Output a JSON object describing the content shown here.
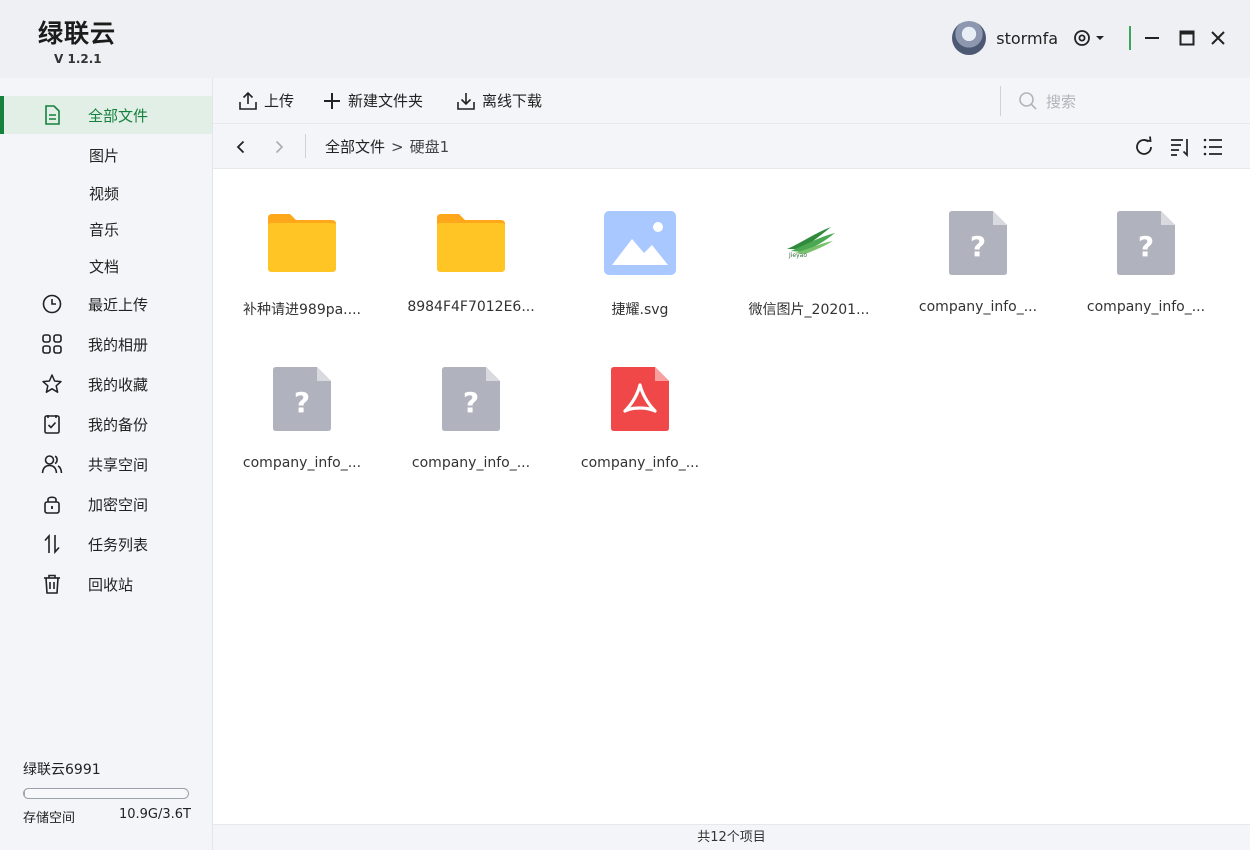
{
  "app": {
    "name": "绿联云",
    "version": "V 1.2.1"
  },
  "user": {
    "name": "stormfa"
  },
  "toolbar": {
    "upload_label": "上传",
    "new_folder_label": "新建文件夹",
    "offline_download_label": "离线下载",
    "search_placeholder": "搜索"
  },
  "breadcrumb": {
    "root": "全部文件",
    "sep": ">",
    "current": "硬盘1"
  },
  "sidebar": {
    "items": [
      {
        "label": "全部文件",
        "icon": "file-icon",
        "active": true
      },
      {
        "label": "图片"
      },
      {
        "label": "视频"
      },
      {
        "label": "音乐"
      },
      {
        "label": "文档"
      },
      {
        "label": "最近上传",
        "icon": "clock-icon"
      },
      {
        "label": "我的相册",
        "icon": "grid-icon"
      },
      {
        "label": "我的收藏",
        "icon": "star-icon"
      },
      {
        "label": "我的备份",
        "icon": "backup-icon"
      },
      {
        "label": "共享空间",
        "icon": "users-icon"
      },
      {
        "label": "加密空间",
        "icon": "lock-icon"
      },
      {
        "label": "任务列表",
        "icon": "transfer-icon"
      },
      {
        "label": "回收站",
        "icon": "trash-icon"
      }
    ],
    "storage": {
      "device": "绿联云6991",
      "label": "存储空间",
      "usage": "10.9G/3.6T",
      "used_fraction": 0.003
    }
  },
  "files": [
    {
      "name": "补种请进989pa....",
      "type": "folder"
    },
    {
      "name": "8984F4F7012E6...",
      "type": "folder"
    },
    {
      "name": "捷耀.svg",
      "type": "image"
    },
    {
      "name": "微信图片_20201...",
      "type": "thumbnail"
    },
    {
      "name": "company_info_...",
      "type": "unknown"
    },
    {
      "name": "company_info_...",
      "type": "unknown"
    },
    {
      "name": "company_info_...",
      "type": "unknown"
    },
    {
      "name": "company_info_...",
      "type": "unknown"
    },
    {
      "name": "company_info_...",
      "type": "pdf"
    }
  ],
  "status": {
    "count_text": "共12个项目"
  },
  "colors": {
    "accent": "#14813c",
    "folder": "#ffc524",
    "pdf": "#f04848",
    "unknown": "#b0b3bd",
    "image": "#a9c8ff"
  }
}
